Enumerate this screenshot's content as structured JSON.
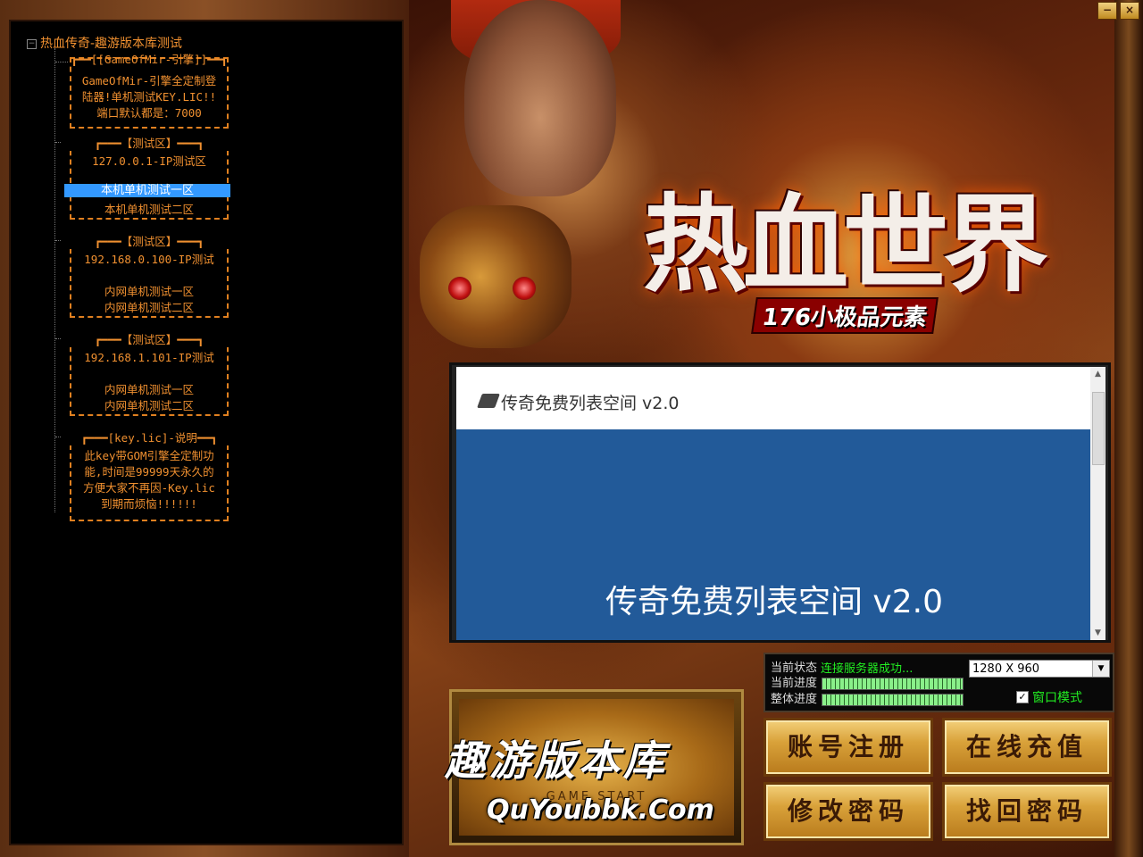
{
  "window": {
    "minimize_label": "−",
    "close_label": "×"
  },
  "banner": {
    "title": "热血世界",
    "subtitle": "176小极品元素"
  },
  "tree": {
    "root": "热血传奇-趣游版本库测试",
    "expander": "−",
    "groups": [
      {
        "lines": [
          "┏━━[[GameOfMir-引擎]]━━┓",
          "GameOfMir-引擎全定制登",
          "陆器!单机测试KEY.LIC!!",
          "端口默认都是：7000"
        ]
      },
      {
        "lines": [
          "┏━━━【测试区】━━━┓",
          "127.0.0.1-IP测试区"
        ],
        "items": [
          "本机单机测试一区",
          "本机单机测试二区"
        ]
      },
      {
        "lines": [
          "┏━━━【测试区】━━━┓",
          "192.168.0.100-IP测试"
        ],
        "items": [
          "内网单机测试一区",
          "内网单机测试二区"
        ]
      },
      {
        "lines": [
          "┏━━━【测试区】━━━┓",
          "192.168.1.101-IP测试"
        ],
        "items": [
          "内网单机测试一区",
          "内网单机测试二区"
        ]
      },
      {
        "lines": [
          "┏━━━[key.lic]-说明━━┓",
          "此key带GOM引擎全定制功",
          "能,时间是99999天永久的",
          "方便大家不再因-Key.lic",
          "到期而烦恼!!!!!!"
        ]
      }
    ],
    "selected_item": "本机单机测试一区"
  },
  "browser": {
    "header_title": "传奇免费列表空间 v2.0",
    "body_text": "传奇免费列表空间 v2.0",
    "scroll_up": "▲",
    "scroll_down": "▼"
  },
  "status": {
    "state_label": "当前状态",
    "state_value": "连接服务器成功...",
    "progress_label": "当前进度",
    "overall_label": "整体进度",
    "current_progress": 1.0,
    "overall_progress": 1.0,
    "resolution": "1280 X 960",
    "resolution_dd": "▼",
    "window_mode_label": "窗口模式",
    "window_mode_checked": "✓"
  },
  "start": {
    "label": "GAME START"
  },
  "watermark": {
    "cn": "趣游版本库",
    "en": "QuYoubbk.Com"
  },
  "buttons": {
    "register": "账号注册",
    "recharge": "在线充值",
    "change_password": "修改密码",
    "recover_password": "找回密码"
  }
}
